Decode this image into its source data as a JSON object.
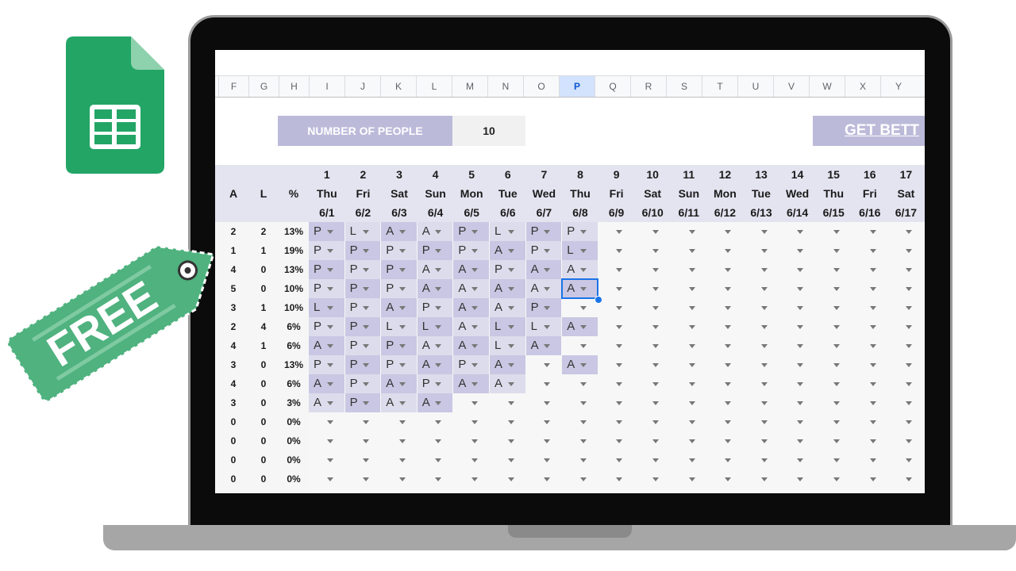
{
  "sheet": {
    "columns": [
      "F",
      "G",
      "H",
      "I",
      "J",
      "K",
      "L",
      "M",
      "N",
      "O",
      "P",
      "Q",
      "R",
      "S",
      "T",
      "U",
      "V",
      "W",
      "X",
      "Y"
    ],
    "selected_column": "P",
    "people_label": "NUMBER OF PEOPLE",
    "people_value": "10",
    "get_better_label": "GET BETT",
    "stat_headers": [
      "A",
      "L",
      "%"
    ],
    "days": [
      {
        "n": "1",
        "d": "Thu",
        "date": "6/1"
      },
      {
        "n": "2",
        "d": "Fri",
        "date": "6/2"
      },
      {
        "n": "3",
        "d": "Sat",
        "date": "6/3"
      },
      {
        "n": "4",
        "d": "Sun",
        "date": "6/4"
      },
      {
        "n": "5",
        "d": "Mon",
        "date": "6/5"
      },
      {
        "n": "6",
        "d": "Tue",
        "date": "6/6"
      },
      {
        "n": "7",
        "d": "Wed",
        "date": "6/7"
      },
      {
        "n": "8",
        "d": "Thu",
        "date": "6/8"
      },
      {
        "n": "9",
        "d": "Fri",
        "date": "6/9"
      },
      {
        "n": "10",
        "d": "Sat",
        "date": "6/10"
      },
      {
        "n": "11",
        "d": "Sun",
        "date": "6/11"
      },
      {
        "n": "12",
        "d": "Mon",
        "date": "6/12"
      },
      {
        "n": "13",
        "d": "Tue",
        "date": "6/13"
      },
      {
        "n": "14",
        "d": "Wed",
        "date": "6/14"
      },
      {
        "n": "15",
        "d": "Thu",
        "date": "6/15"
      },
      {
        "n": "16",
        "d": "Fri",
        "date": "6/16"
      },
      {
        "n": "17",
        "d": "Sat",
        "date": "6/17"
      }
    ],
    "rows": [
      {
        "a": "2",
        "l": "2",
        "pct": "13%",
        "cells": [
          "P",
          "L",
          "A",
          "A",
          "P",
          "L",
          "P",
          "P"
        ]
      },
      {
        "a": "1",
        "l": "1",
        "pct": "19%",
        "cells": [
          "P",
          "P",
          "P",
          "P",
          "P",
          "A",
          "P",
          "L"
        ]
      },
      {
        "a": "4",
        "l": "0",
        "pct": "13%",
        "cells": [
          "P",
          "P",
          "P",
          "A",
          "A",
          "P",
          "A",
          "A"
        ]
      },
      {
        "a": "5",
        "l": "0",
        "pct": "10%",
        "cells": [
          "P",
          "P",
          "P",
          "A",
          "A",
          "A",
          "A",
          "A"
        ]
      },
      {
        "a": "3",
        "l": "1",
        "pct": "10%",
        "cells": [
          "L",
          "P",
          "A",
          "P",
          "A",
          "A",
          "P"
        ]
      },
      {
        "a": "2",
        "l": "4",
        "pct": "6%",
        "cells": [
          "P",
          "P",
          "L",
          "L",
          "A",
          "L",
          "L",
          "A"
        ]
      },
      {
        "a": "4",
        "l": "1",
        "pct": "6%",
        "cells": [
          "A",
          "P",
          "P",
          "A",
          "A",
          "L",
          "A"
        ]
      },
      {
        "a": "3",
        "l": "0",
        "pct": "13%",
        "cells": [
          "P",
          "P",
          "P",
          "A",
          "P",
          "A",
          "",
          "A"
        ]
      },
      {
        "a": "4",
        "l": "0",
        "pct": "6%",
        "cells": [
          "A",
          "P",
          "A",
          "P",
          "A",
          "A"
        ]
      },
      {
        "a": "3",
        "l": "0",
        "pct": "3%",
        "cells": [
          "A",
          "P",
          "A",
          "A"
        ]
      },
      {
        "a": "0",
        "l": "0",
        "pct": "0%",
        "cells": []
      },
      {
        "a": "0",
        "l": "0",
        "pct": "0%",
        "cells": []
      },
      {
        "a": "0",
        "l": "0",
        "pct": "0%",
        "cells": []
      },
      {
        "a": "0",
        "l": "0",
        "pct": "0%",
        "cells": []
      }
    ],
    "selected_cell": {
      "row": 3,
      "day": 7
    }
  },
  "tag": {
    "text": "FREE"
  },
  "icon": {
    "name": "google-sheets-icon",
    "color": "#23a566"
  },
  "colors": {
    "header_purple": "#bcbad9",
    "selection_blue": "#1a73e8",
    "tag_green": "#4fb27f"
  }
}
